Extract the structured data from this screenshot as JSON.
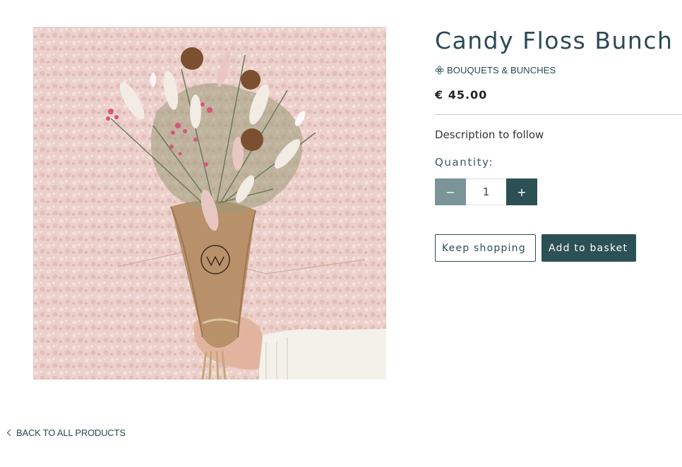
{
  "product": {
    "title": "Candy Floss Bunch",
    "category": "BOUQUETS & BUNCHES",
    "category_icon": "flower-icon",
    "price": "€ 45.00",
    "description": "Description to follow",
    "image_alt": "Dried flower bouquet wrapped in kraft paper held against a pink textured wall"
  },
  "quantity": {
    "label": "Quantity:",
    "value": "1",
    "minus_label": "−",
    "plus_label": "+"
  },
  "actions": {
    "keep_shopping": "Keep shopping",
    "add_to_basket": "Add to basket"
  },
  "footer": {
    "back_link": "BACK TO ALL PRODUCTS",
    "back_icon": "chevron-left-icon"
  },
  "colors": {
    "accent": "#2b5056",
    "accent_muted": "#7a9497",
    "title": "#2b4a50",
    "wall": "#ecd0cb"
  }
}
